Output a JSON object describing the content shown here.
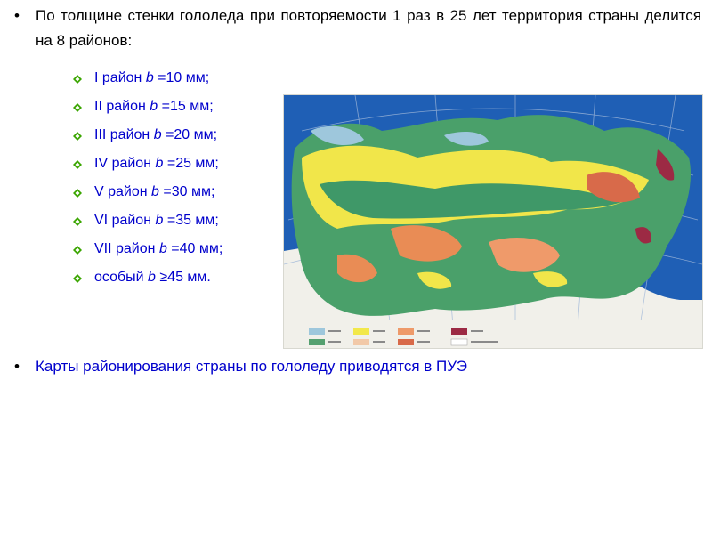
{
  "intro": {
    "text": "По толщине стенки гололеда при повторяемости 1 раз в 25 лет территория страны делится на 8 районов:"
  },
  "districts": [
    {
      "name": "I район",
      "symbol": "b",
      "value": "=10 мм;"
    },
    {
      "name": "II район",
      "symbol": "b",
      "value": "=15 мм;"
    },
    {
      "name": "III район",
      "symbol": "b",
      "value": "=20 мм;"
    },
    {
      "name": "IV район",
      "symbol": "b",
      "value": "=25 мм;"
    },
    {
      "name": "V район",
      "symbol": "b",
      "value": "=30 мм;"
    },
    {
      "name": "VI район",
      "symbol": "b",
      "value": "=35 мм;"
    },
    {
      "name": "VII район",
      "symbol": "b",
      "value": "=40 мм;"
    },
    {
      "name": "особый",
      "symbol": "b",
      "value": "≥45 мм."
    }
  ],
  "outro": {
    "text": "Карты районирования страны по гололеду приводятся в ПУЭ"
  },
  "map": {
    "legend_colors": [
      "#9ec7dc",
      "#f2e84a",
      "#ee9a6a",
      "#9c2a44",
      "#55a070",
      "#f2c9a8",
      "#d86a4a",
      "#ffffff"
    ]
  },
  "colors": {
    "list_text": "#0000cc",
    "diamond_icon": "#3aa500",
    "body_text": "#000000"
  }
}
